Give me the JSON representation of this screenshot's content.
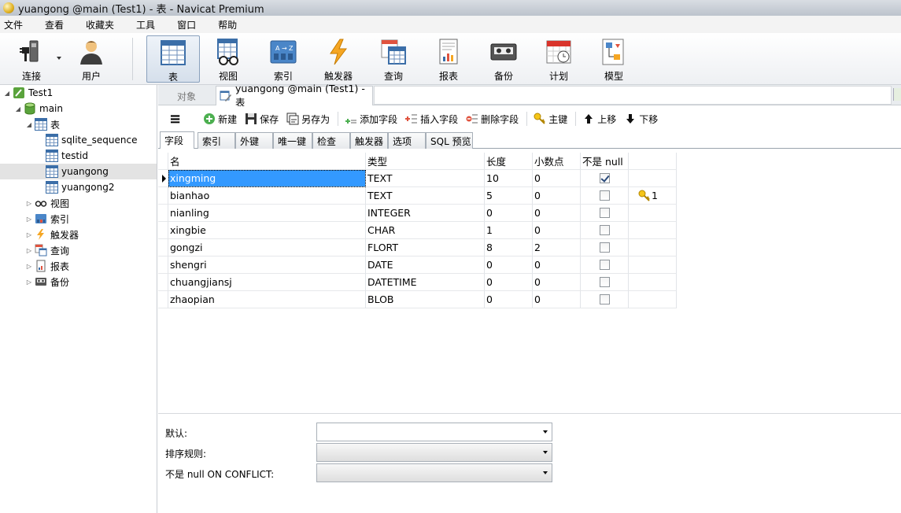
{
  "window": {
    "title": "yuangong @main (Test1) - 表 - Navicat Premium"
  },
  "menubar": [
    "文件",
    "查看",
    "收藏夹",
    "工具",
    "窗口",
    "帮助"
  ],
  "toolbar": {
    "connect": "连接",
    "user": "用户",
    "items": [
      "表",
      "视图",
      "索引",
      "触发器",
      "查询",
      "报表",
      "备份",
      "计划",
      "模型"
    ],
    "active": "表"
  },
  "tree": {
    "connection": "Test1",
    "database": "main",
    "tables_group": "表",
    "tables": [
      "sqlite_sequence",
      "testid",
      "yuangong",
      "yuangong2"
    ],
    "selected_table": "yuangong",
    "groups": [
      "视图",
      "索引",
      "触发器",
      "查询",
      "报表",
      "备份"
    ]
  },
  "tabs": {
    "objects": "对象",
    "active": "yuangong @main (Test1) - 表"
  },
  "actions": {
    "menu": "≡",
    "new": "新建",
    "save": "保存",
    "save_as": "另存为",
    "add_field": "添加字段",
    "insert_field": "插入字段",
    "delete_field": "删除字段",
    "primary_key": "主键",
    "move_up": "上移",
    "move_down": "下移"
  },
  "subtabs": [
    "字段",
    "索引",
    "外键",
    "唯一键",
    "检查",
    "触发器",
    "选项",
    "SQL 预览"
  ],
  "grid": {
    "headers": [
      "名",
      "类型",
      "长度",
      "小数点",
      "不是 null",
      ""
    ],
    "rows": [
      {
        "name": "xingming",
        "type": "TEXT",
        "length": "10",
        "decimals": "0",
        "not_null": true,
        "key": ""
      },
      {
        "name": "bianhao",
        "type": "TEXT",
        "length": "5",
        "decimals": "0",
        "not_null": false,
        "key": "1"
      },
      {
        "name": "nianling",
        "type": "INTEGER",
        "length": "0",
        "decimals": "0",
        "not_null": false,
        "key": ""
      },
      {
        "name": "xingbie",
        "type": "CHAR",
        "length": "1",
        "decimals": "0",
        "not_null": false,
        "key": ""
      },
      {
        "name": "gongzi",
        "type": "FLORT",
        "length": "8",
        "decimals": "2",
        "not_null": false,
        "key": ""
      },
      {
        "name": "shengri",
        "type": "DATE",
        "length": "0",
        "decimals": "0",
        "not_null": false,
        "key": ""
      },
      {
        "name": "chuangjiansj",
        "type": "DATETIME",
        "length": "0",
        "decimals": "0",
        "not_null": false,
        "key": ""
      },
      {
        "name": "zhaopian",
        "type": "BLOB",
        "length": "0",
        "decimals": "0",
        "not_null": false,
        "key": ""
      }
    ]
  },
  "properties": {
    "default_label": "默认:",
    "collation_label": "排序规则:",
    "not_null_conflict_label": "不是 null ON CONFLICT:",
    "default_value": "",
    "collation_value": "",
    "not_null_conflict_value": ""
  }
}
